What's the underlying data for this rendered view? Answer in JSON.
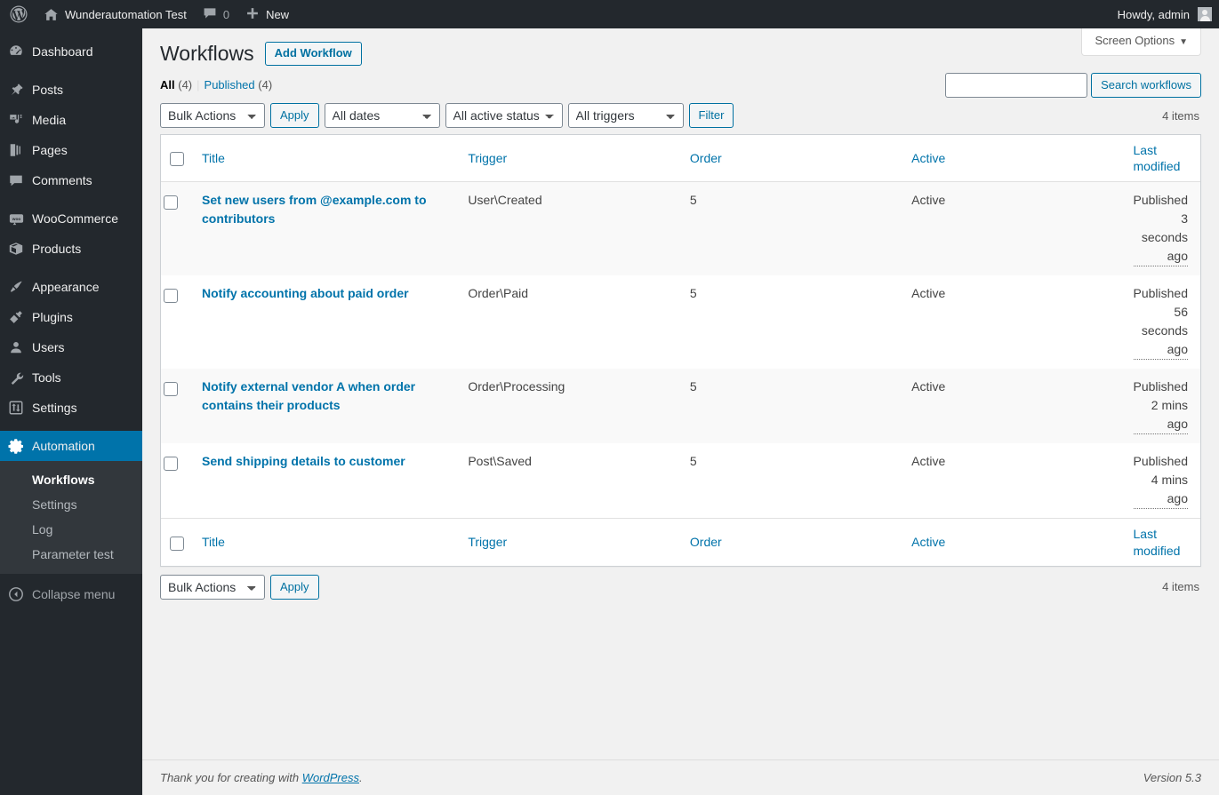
{
  "adminbar": {
    "logo_icon": "wordpress-logo-icon",
    "site_name": "Wunderautomation Test",
    "home_icon": "home-icon",
    "comments_icon": "comment-bubble-icon",
    "comments_count": "0",
    "new_icon": "plus-icon",
    "new_label": "New",
    "howdy": "Howdy, admin",
    "avatar_icon": "user-avatar-icon"
  },
  "sidebar": {
    "items": [
      {
        "label": "Dashboard",
        "icon": "dashboard-icon",
        "current": false
      },
      {
        "label": "Posts",
        "icon": "pin-icon",
        "current": false
      },
      {
        "label": "Media",
        "icon": "media-icon",
        "current": false
      },
      {
        "label": "Pages",
        "icon": "pages-icon",
        "current": false
      },
      {
        "label": "Comments",
        "icon": "comment-icon",
        "current": false
      },
      {
        "label": "WooCommerce",
        "icon": "woocommerce-icon",
        "current": false
      },
      {
        "label": "Products",
        "icon": "box-icon",
        "current": false
      },
      {
        "label": "Appearance",
        "icon": "paintbrush-icon",
        "current": false
      },
      {
        "label": "Plugins",
        "icon": "plug-icon",
        "current": false
      },
      {
        "label": "Users",
        "icon": "user-icon",
        "current": false
      },
      {
        "label": "Tools",
        "icon": "wrench-icon",
        "current": false
      },
      {
        "label": "Settings",
        "icon": "sliders-icon",
        "current": false
      },
      {
        "label": "Automation",
        "icon": "gear-icon",
        "current": true
      }
    ],
    "submenu": [
      {
        "label": "Workflows",
        "current": true
      },
      {
        "label": "Settings",
        "current": false
      },
      {
        "label": "Log",
        "current": false
      },
      {
        "label": "Parameter test",
        "current": false
      }
    ],
    "collapse_label": "Collapse menu",
    "collapse_icon": "collapse-arrow-icon",
    "accent_color": "#0073aa"
  },
  "screen_options": {
    "label": "Screen Options",
    "caret": "▼"
  },
  "page": {
    "title": "Workflows",
    "add_button": "Add Workflow"
  },
  "views": {
    "all_label": "All",
    "all_count": "(4)",
    "separator": "|",
    "published_label": "Published",
    "published_count": "(4)"
  },
  "search": {
    "value": "",
    "placeholder": "",
    "button": "Search workflows"
  },
  "tablenav_top": {
    "bulk_actions": "Bulk Actions",
    "apply": "Apply",
    "dates": "All dates",
    "active_status": "All active status",
    "triggers": "All triggers",
    "filter": "Filter",
    "items_count": "4 items"
  },
  "tablenav_bottom": {
    "bulk_actions": "Bulk Actions",
    "apply": "Apply",
    "items_count": "4 items"
  },
  "table": {
    "columns": {
      "title": "Title",
      "trigger": "Trigger",
      "order": "Order",
      "active": "Active",
      "modified": "Last modified"
    },
    "rows": [
      {
        "title": "Set new users from @example.com to contributors",
        "trigger": "User\\Created",
        "order": "5",
        "active": "Active",
        "status": "Published",
        "ago": "3 seconds ago"
      },
      {
        "title": "Notify accounting about paid order",
        "trigger": "Order\\Paid",
        "order": "5",
        "active": "Active",
        "status": "Published",
        "ago": "56 seconds ago"
      },
      {
        "title": "Notify external vendor A when order contains their products",
        "trigger": "Order\\Processing",
        "order": "5",
        "active": "Active",
        "status": "Published",
        "ago": "2 mins ago"
      },
      {
        "title": "Send shipping details to customer",
        "trigger": "Post\\Saved",
        "order": "5",
        "active": "Active",
        "status": "Published",
        "ago": "4 mins ago"
      }
    ]
  },
  "footer": {
    "thanks_prefix": "Thank you for creating with ",
    "wordpress_link": "WordPress",
    "thanks_suffix": ".",
    "version": "Version 5.3"
  }
}
